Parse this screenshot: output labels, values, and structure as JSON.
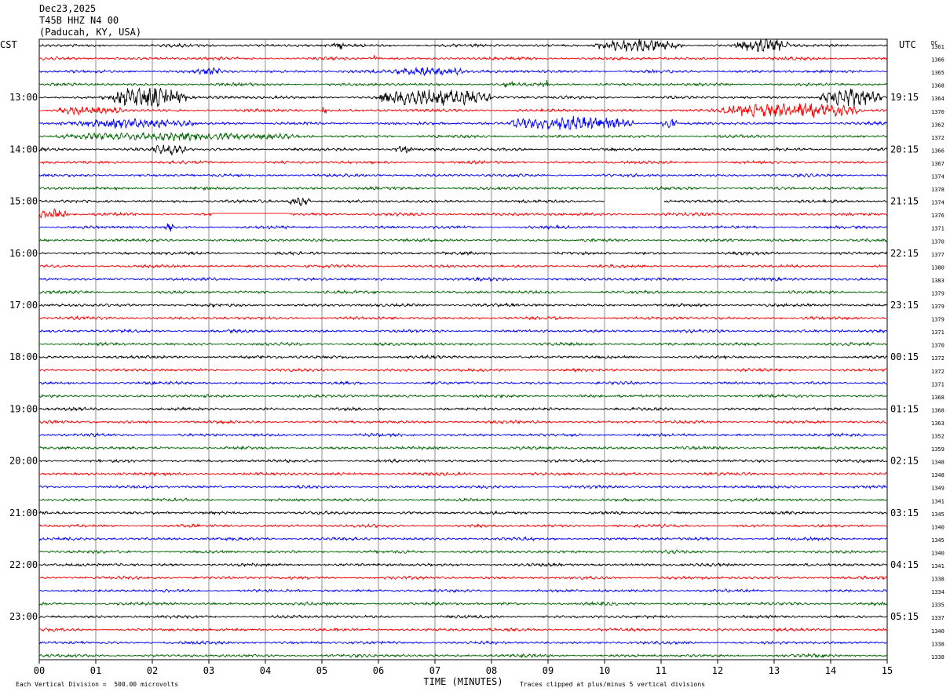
{
  "header": {
    "date": "Dec23,2025",
    "station": "T45B HHZ N4 00",
    "location": "(Paducah, KY, USA)"
  },
  "left_tz": "CST",
  "right_tz": "UTC",
  "dc_label": "DC",
  "footer": {
    "scale_text": "Each Vertical Division =  500.00 microvolts",
    "clip_text": "Traces clipped at plus/minus 5 vertical divisions"
  },
  "chart_data": {
    "type": "line",
    "title": "",
    "xlabel": "TIME (MINUTES)",
    "ylabel": "",
    "xlim": [
      0,
      15
    ],
    "x_ticks": [
      "00",
      "01",
      "02",
      "03",
      "04",
      "05",
      "06",
      "07",
      "08",
      "09",
      "10",
      "11",
      "12",
      "13",
      "14",
      "15"
    ],
    "trace_colors": [
      "#000000",
      "#ff0000",
      "#0000ff",
      "#006400"
    ],
    "grid": "vertical lines every minute",
    "left_hour_labels": [
      "13:00",
      "14:00",
      "15:00",
      "16:00",
      "17:00",
      "18:00",
      "19:00",
      "20:00",
      "21:00",
      "22:00",
      "23:00"
    ],
    "right_hour_labels": [
      "19:15",
      "20:15",
      "21:15",
      "22:15",
      "23:15",
      "00:15",
      "01:15",
      "02:15",
      "03:15",
      "04:15",
      "05:15"
    ],
    "dc_offsets": [
      1361,
      1366,
      1365,
      1368,
      1364,
      1370,
      1362,
      1372,
      1366,
      1367,
      1374,
      1378,
      1374,
      1376,
      1371,
      1370,
      1377,
      1380,
      1383,
      1379,
      1379,
      1379,
      1371,
      1370,
      1372,
      1372,
      1371,
      1368,
      1368,
      1363,
      1352,
      1359,
      1348,
      1348,
      1349,
      1341,
      1345,
      1340,
      1345,
      1340,
      1341,
      1338,
      1334,
      1335,
      1337,
      1340,
      1338,
      1338
    ],
    "events": [
      {
        "trace": 0,
        "from_min": 5.2,
        "to_min": 5.4,
        "level": 2.0
      },
      {
        "trace": 0,
        "from_min": 9.8,
        "to_min": 11.4,
        "level": 2.3
      },
      {
        "trace": 0,
        "from_min": 12.3,
        "to_min": 13.3,
        "level": 2.5
      },
      {
        "trace": 1,
        "from_min": 5.9,
        "to_min": 6.0,
        "level": 1.6
      },
      {
        "trace": 2,
        "from_min": 2.8,
        "to_min": 3.2,
        "level": 1.3
      },
      {
        "trace": 2,
        "from_min": 6.3,
        "to_min": 7.5,
        "level": 1.8
      },
      {
        "trace": 3,
        "from_min": 8.2,
        "to_min": 8.4,
        "level": 1.5
      },
      {
        "trace": 3,
        "from_min": 8.9,
        "to_min": 9.0,
        "level": 1.8
      },
      {
        "trace": 4,
        "from_min": 1.3,
        "to_min": 2.6,
        "level": 4.5
      },
      {
        "trace": 4,
        "from_min": 6.0,
        "to_min": 8.0,
        "level": 3.5
      },
      {
        "trace": 4,
        "from_min": 13.8,
        "to_min": 14.9,
        "level": 3.5
      },
      {
        "trace": 5,
        "from_min": 0.3,
        "to_min": 1.5,
        "level": 1.5
      },
      {
        "trace": 5,
        "from_min": 5.0,
        "to_min": 5.1,
        "level": 2.5
      },
      {
        "trace": 5,
        "from_min": 12.0,
        "to_min": 14.5,
        "level": 3.0
      },
      {
        "trace": 6,
        "from_min": 0.3,
        "to_min": 2.8,
        "level": 1.6
      },
      {
        "trace": 6,
        "from_min": 8.3,
        "to_min": 10.5,
        "level": 2.8
      },
      {
        "trace": 6,
        "from_min": 11.0,
        "to_min": 11.3,
        "level": 2.0
      },
      {
        "trace": 7,
        "from_min": 0.3,
        "to_min": 4.5,
        "level": 1.3
      },
      {
        "trace": 8,
        "from_min": 2.0,
        "to_min": 2.6,
        "level": 2.0
      },
      {
        "trace": 8,
        "from_min": 6.3,
        "to_min": 6.6,
        "level": 1.5
      },
      {
        "trace": 12,
        "from_min": 4.4,
        "to_min": 4.8,
        "level": 2.0
      },
      {
        "trace": 13,
        "from_min": 0.0,
        "to_min": 0.5,
        "level": 2.0
      },
      {
        "trace": 14,
        "from_min": 2.2,
        "to_min": 2.4,
        "level": 1.5
      }
    ],
    "gaps": [
      {
        "trace": 12,
        "from_min": 10.0,
        "to_min": 11.05
      },
      {
        "trace": 13,
        "from_min": 3.05,
        "to_min": 4.45
      }
    ]
  }
}
